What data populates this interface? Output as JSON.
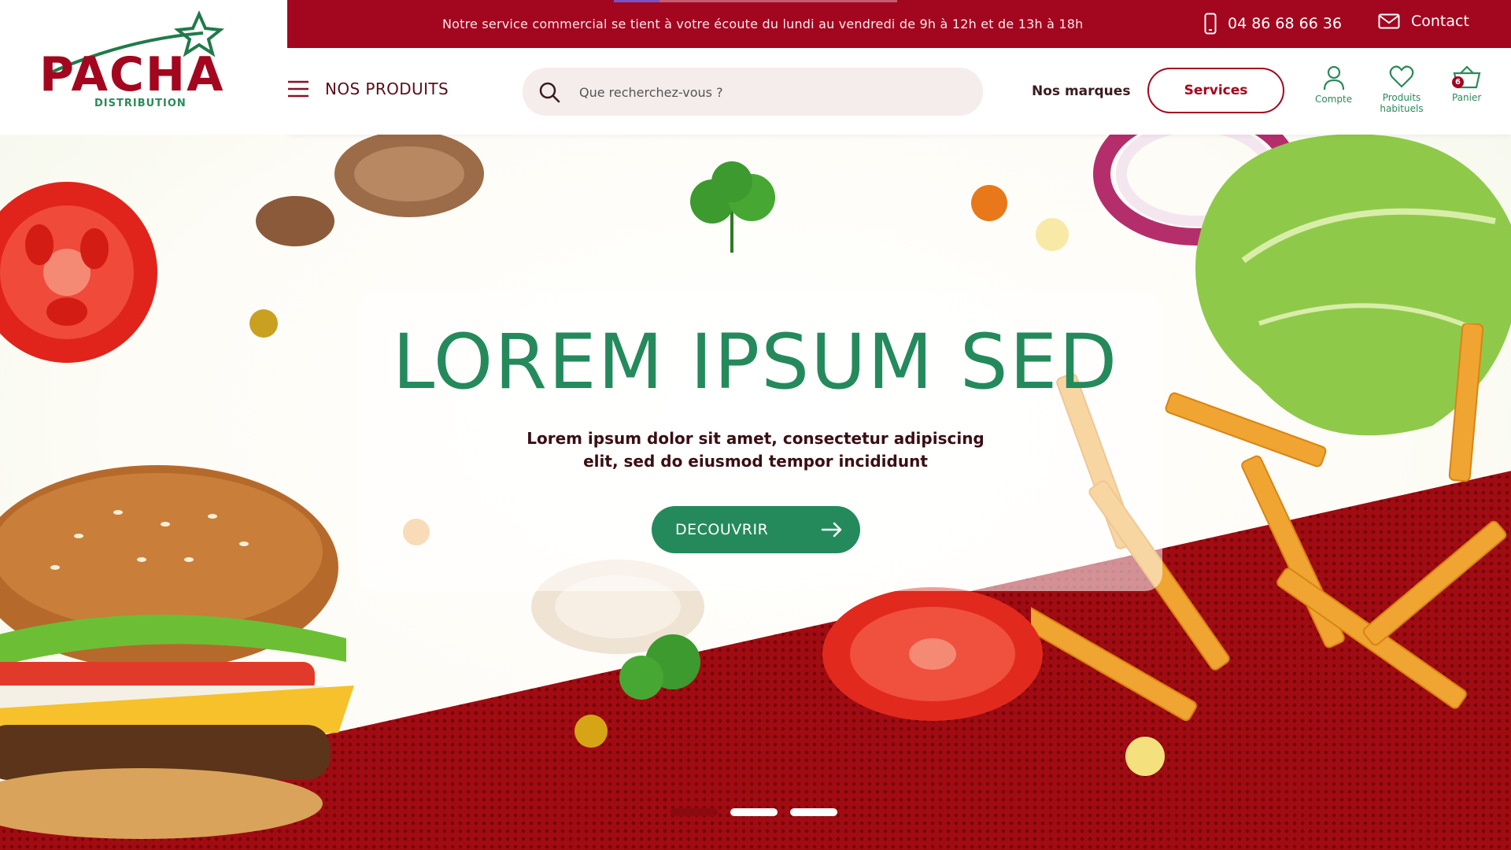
{
  "brand": {
    "name": "PACHA",
    "subtitle": "DISTRIBUTION",
    "color_red": "#a3061f",
    "color_green": "#248a5c"
  },
  "topbar": {
    "message": "Notre service commercial se tient à votre écoute du lundi au vendredi  de 9h à 12h et de 13h à 18h",
    "phone": "04 86 68 66 36",
    "contact_label": "Contact",
    "slide_progress": 0.16
  },
  "nav": {
    "menu_label": "NOS PRODUITS",
    "search_placeholder": "Que recherchez-vous ?",
    "brands_label": "Nos marques",
    "services_label": "Services",
    "account_label": "Compte",
    "favorites_label": "Produits habituels",
    "cart_label": "Panier",
    "cart_count": "6"
  },
  "hero": {
    "title": "LOREM IPSUM SED",
    "subtitle_line1": "Lorem ipsum dolor sit amet, consectetur adipiscing",
    "subtitle_line2": "elit, sed do eiusmod tempor incididunt",
    "cta_label": "DECOUVRIR"
  },
  "carousel": {
    "slide_count": 3,
    "active_index": 0,
    "active_color": "#8b0a10",
    "inactive_color": "#ffffff"
  }
}
